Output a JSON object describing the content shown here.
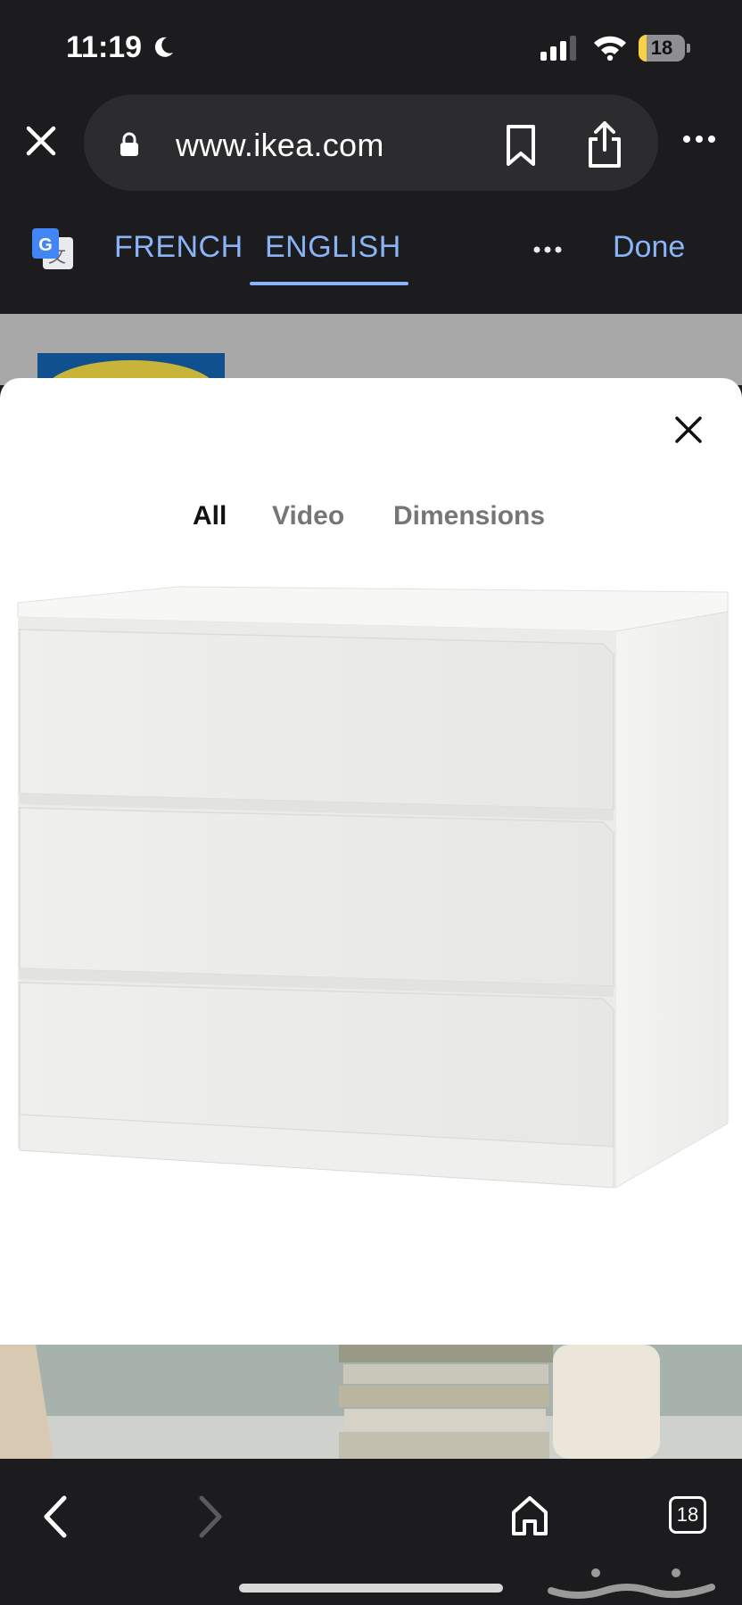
{
  "status_bar": {
    "time": "11:19",
    "battery_level": "18",
    "battery_fraction": 0.18,
    "icons": [
      "moon-icon",
      "cellular-signal-icon",
      "wifi-icon",
      "battery-icon"
    ]
  },
  "browser": {
    "url": "www.ikea.com",
    "icons": [
      "close-icon",
      "lock-icon",
      "bookmark-icon",
      "share-icon",
      "more-icon"
    ]
  },
  "translate": {
    "source_lang": "FRENCH",
    "target_lang": "ENGLISH",
    "selected": "ENGLISH",
    "done_label": "Done",
    "icons": [
      "google-translate-icon",
      "more-icon"
    ]
  },
  "media_sheet": {
    "tabs": [
      {
        "label": "All",
        "active": true
      },
      {
        "label": "Video",
        "active": false
      },
      {
        "label": "Dimensions",
        "active": false
      }
    ],
    "icons": [
      "close-icon"
    ]
  },
  "bottom_nav": {
    "tab_count": "18",
    "icons": [
      "back-icon",
      "forward-icon",
      "home-icon",
      "tabs-icon"
    ]
  },
  "colors": {
    "accent": "#8ab4f8",
    "chrome": "#1c1c1e",
    "sheet": "#ffffff",
    "battery": "#f7d046"
  }
}
